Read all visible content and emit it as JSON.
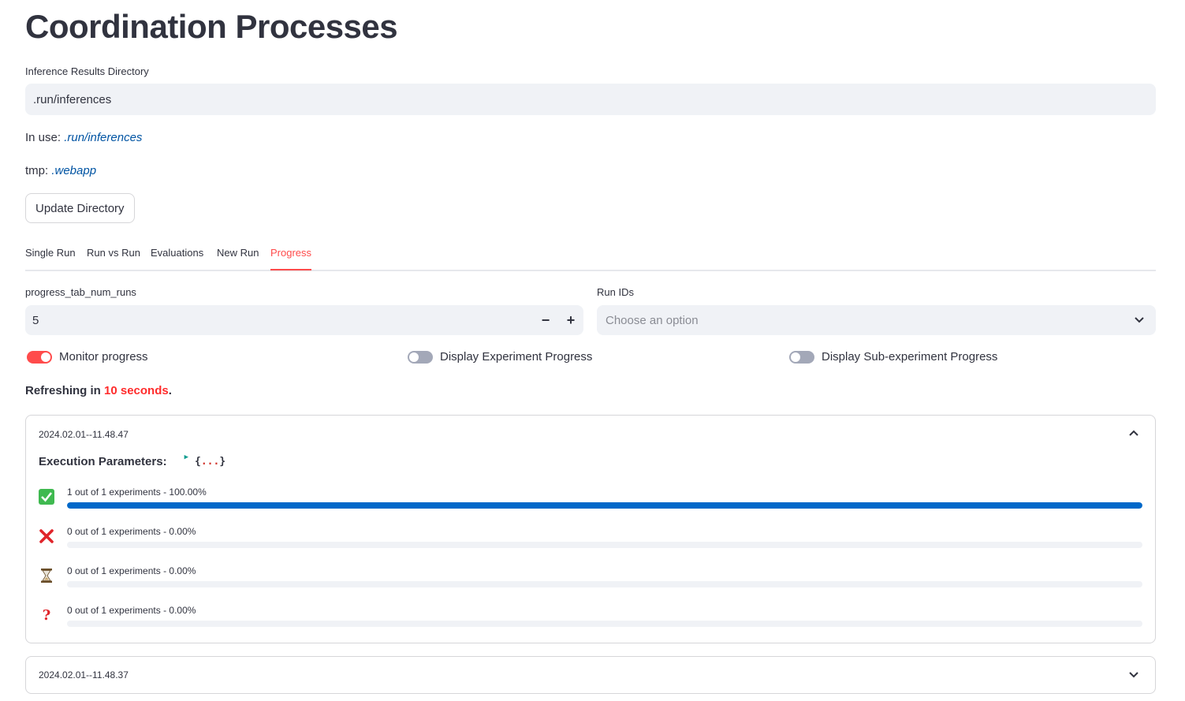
{
  "page": {
    "title": "Coordination Processes"
  },
  "directory": {
    "label": "Inference Results Directory",
    "value": ".run/inferences",
    "in_use_prefix": "In use: ",
    "in_use_value": ".run/inferences",
    "tmp_prefix": "tmp: ",
    "tmp_value": ".webapp",
    "update_button": "Update Directory"
  },
  "tabs": [
    {
      "label": "Single Run",
      "active": false
    },
    {
      "label": "Run vs Run",
      "active": false
    },
    {
      "label": "Evaluations",
      "active": false
    },
    {
      "label": "New Run",
      "active": false
    },
    {
      "label": "Progress",
      "active": true
    }
  ],
  "controls": {
    "num_runs_label": "progress_tab_num_runs",
    "num_runs_value": "5",
    "minus": "−",
    "plus": "+",
    "run_ids_label": "Run IDs",
    "run_ids_placeholder": "Choose an option"
  },
  "toggles": [
    {
      "label": "Monitor progress",
      "on": true
    },
    {
      "label": "Display Experiment Progress",
      "on": false
    },
    {
      "label": "Display Sub-experiment Progress",
      "on": false
    }
  ],
  "refresh": {
    "prefix": "Refreshing in ",
    "value": "10 seconds",
    "suffix": "."
  },
  "expanders": [
    {
      "title": "2024.02.01--11.48.47",
      "expanded": true,
      "params_label": "Execution Parameters:",
      "params_open": "{",
      "params_dots": "...",
      "params_close": "}",
      "rows": [
        {
          "icon": "check-mark-icon",
          "text": "1 out of 1 experiments - 100.00%",
          "fraction": 1.0
        },
        {
          "icon": "cross-mark-icon",
          "text": "0 out of 1 experiments - 0.00%",
          "fraction": 0.0
        },
        {
          "icon": "hourglass-icon",
          "text": "0 out of 1 experiments - 0.00%",
          "fraction": 0.0
        },
        {
          "icon": "question-mark-icon",
          "text": "0 out of 1 experiments - 0.00%",
          "fraction": 0.0
        }
      ]
    },
    {
      "title": "2024.02.01--11.48.37",
      "expanded": false
    }
  ],
  "colors": {
    "accent": "#ff4b4b",
    "progress": "#0068c9",
    "link": "#0054a3"
  }
}
